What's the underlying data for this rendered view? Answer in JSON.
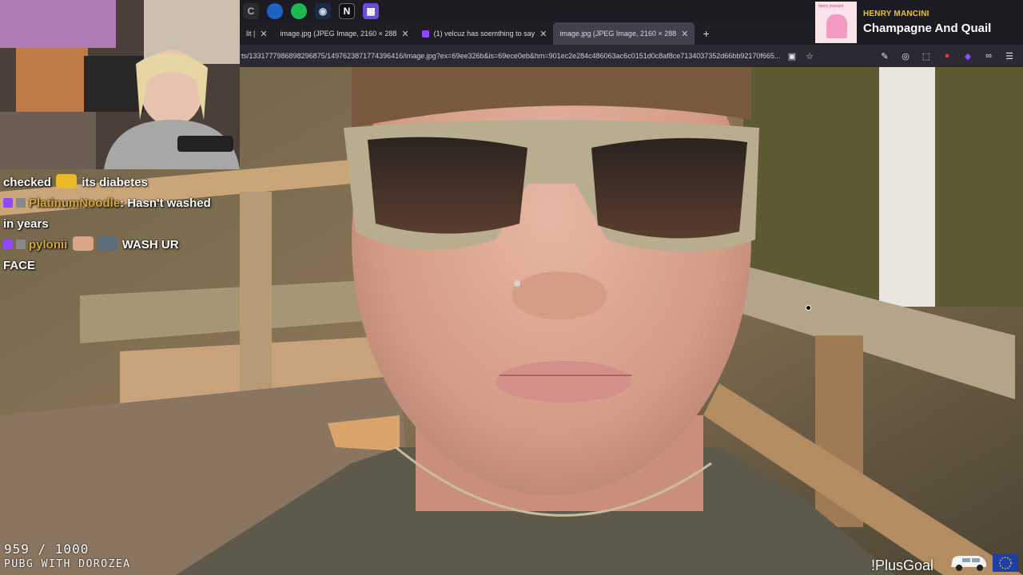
{
  "taskbar": {
    "icons": [
      "refresh-icon",
      "firefox-icon",
      "spotify-icon",
      "steam-icon",
      "notion-icon",
      "grid-app-icon"
    ],
    "notion_glyph": "N"
  },
  "browser": {
    "tabs": [
      {
        "label": "lit |",
        "active": false
      },
      {
        "label": "image.jpg (JPEG Image, 2160 × 288",
        "active": false
      },
      {
        "label": "(1) velcuz has soemthing to say",
        "active": false
      },
      {
        "label": "image.jpg (JPEG Image, 2160 × 288",
        "active": true
      }
    ],
    "close_glyph": "✕",
    "new_tab_glyph": "+",
    "url": "ts/1331777986898296875/1497623871774396416/image.jpg?ex=69ee326b&is=69ece0eb&hm=901ec2e284c486063ac6c0151d0c8af8ce7134037352d66bb92170f665..."
  },
  "now_playing": {
    "artist": "HENRY MANCINI",
    "title": "Champagne And Quail",
    "art_text": "henry mancini"
  },
  "chat": {
    "messages": [
      {
        "parts": [
          "checked",
          "its diabetes"
        ],
        "user": ""
      },
      {
        "user": "PlatinumNoodle",
        "text": ": Hasn't washed in years"
      },
      {
        "user": "pylonii",
        "text": "WASH UR FACE"
      }
    ],
    "line1_pre": "checked",
    "line1_post": "its diabetes",
    "line2_user": "PlatinumNoodle",
    "line2_text": ": Hasn't washed",
    "line2_cont": "in years",
    "line3_user": "pylonii",
    "line3_text": "WASH UR",
    "line3_cont": "FACE"
  },
  "overlay": {
    "counter": "959 / 1000",
    "goal_label": "PUBG WITH DOROZEA",
    "plus_goal": "!PlusGoal"
  },
  "colors": {
    "chat_username": "#d4a838",
    "now_playing_artist": "#f1c40f",
    "twitch_purple": "#9147ff",
    "browser_chrome": "#2b2a33"
  }
}
